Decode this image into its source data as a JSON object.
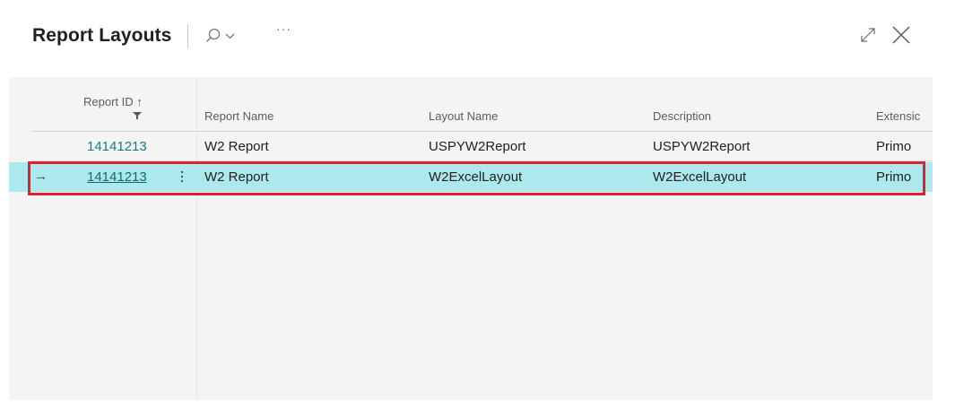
{
  "header": {
    "title": "Report Layouts",
    "search_icon": "search-icon",
    "more_label": "···",
    "expand_icon": "expand-icon",
    "close_icon": "close-icon"
  },
  "columns": {
    "report_id": "Report ID ↑",
    "report_name": "Report Name",
    "layout_name": "Layout Name",
    "description": "Description",
    "extension": "Extensic"
  },
  "rows": [
    {
      "report_id": "14141213",
      "report_name": "W2 Report",
      "layout_name": "USPYW2Report",
      "description": "USPYW2Report",
      "extension": "Primo"
    },
    {
      "report_id": "14141213",
      "report_name": "W2 Report",
      "layout_name": "W2ExcelLayout",
      "description": "W2ExcelLayout",
      "extension": "Primo",
      "selected_marker": "→"
    }
  ],
  "colors": {
    "accent": "#147d80",
    "selected_row": "#ade8ec",
    "highlight_border": "#e0202c"
  }
}
